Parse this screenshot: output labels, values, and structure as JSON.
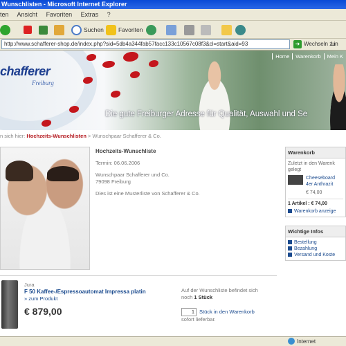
{
  "window": {
    "title": "Wunschlisten - Microsoft Internet Explorer"
  },
  "menu": [
    "ten",
    "Ansicht",
    "Favoriten",
    "Extras",
    "?"
  ],
  "toolbar": {
    "search": "Suchen",
    "favorites": "Favoriten"
  },
  "address": {
    "url": "http://www.schafferer-shop.de/index.php?sid=5db4a344fab57facc133c10567c08f3&cl=start&aid=93",
    "go": "Wechseln zu",
    "links": "Lin"
  },
  "banner": {
    "logo": "chafferer",
    "logo_sub": "Freiburg",
    "slogan": "Die gute Freiburger Adresse für Qualität, Auswahl und Se",
    "nav": [
      "Home",
      "Warenkorb",
      "Mein K"
    ]
  },
  "breadcrumb": {
    "prefix": "n sich hier:",
    "link": "Hochzeits-Wunschlisten",
    "sep": ">",
    "current": "Wunschpaar Schafferer & Co."
  },
  "wishlist": {
    "title": "Hochzeits-Wunschliste",
    "date": "Termin: 06.06.2006",
    "couple": "Wunschpaar Schafferer und Co.",
    "city": "79098 Freiburg",
    "note": "Dies ist eine Musterliste von Schafferer & Co."
  },
  "cart": {
    "title": "Warenkorb",
    "recent_1": "Zuletzt in den Warenk",
    "recent_2": "gelegt",
    "item_1": "Cheeseboard",
    "item_2": "4er Anthrazit",
    "item_price": "€ 74,00",
    "summary": "1 Artikel : € 74,00",
    "show": "Warenkorb anzeige"
  },
  "infos": {
    "title": "Wichtige Infos",
    "items": [
      "Bestellung",
      "Bezahlung",
      "Versand und Koste"
    ]
  },
  "product": {
    "brand": "Jura",
    "name": "F 50 Kaffee-/Espressoautomat Impressa platin",
    "link": "zum Produkt",
    "price": "€ 879,00",
    "wish_1": "Auf der Wunschliste befindet sich",
    "wish_2": "noch",
    "wish_count": "1 Stück",
    "qty": "1",
    "add": "Stück in den Warenkorb",
    "delivery": "sofort lieferbar."
  },
  "status": {
    "zone": "Internet"
  }
}
